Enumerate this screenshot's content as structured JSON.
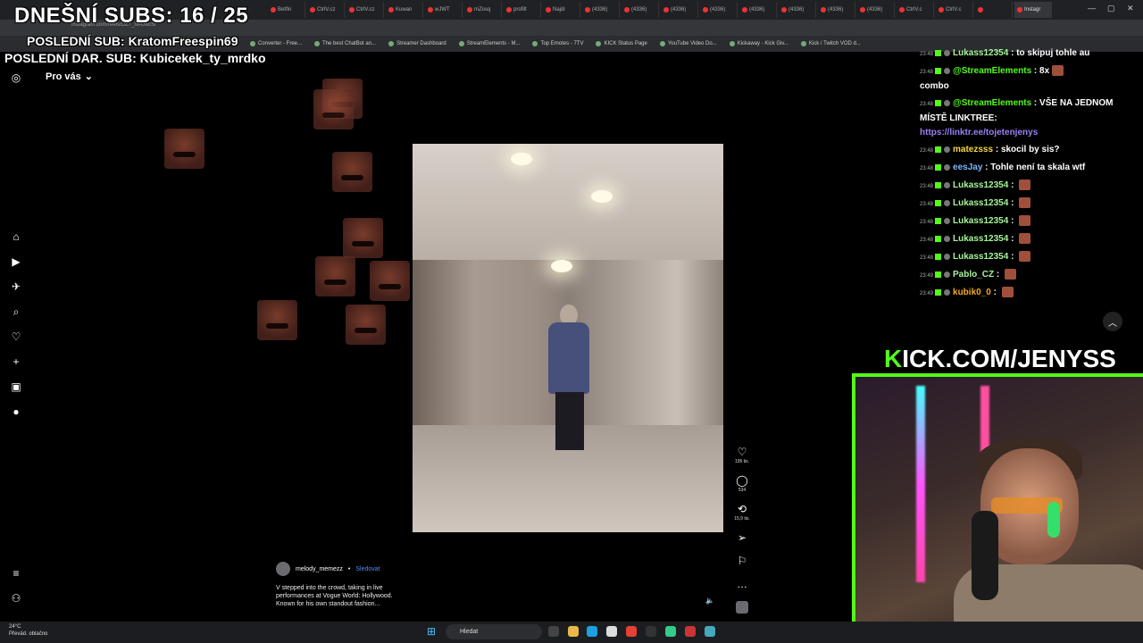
{
  "overlay": {
    "subs_goal": "DNEŠNÍ SUBS: 16 / 25",
    "last_sub": "POSLEDNÍ SUB: KratomFreespin69",
    "last_dar_sub": "POSLEDNÍ DAR. SUB: Kubicekek_ty_mrdko"
  },
  "browser": {
    "url": "instagram.com/reels/DZ7_t9AJwc5/",
    "tabs": [
      "Betfin",
      "CtrlV.cz",
      "CtrlV.cz",
      "Kuwan",
      "wJWT",
      "mZosq",
      "profilt",
      "Najdi",
      "(4336)",
      "(4336)",
      "(4336)",
      "(4336)",
      "(4336)",
      "(4336)",
      "(4336)",
      "(4336)",
      "CtrlV.c",
      "CtrlV.c",
      "",
      "Instagr"
    ],
    "bookmarks": [
      "Converter - Free...",
      "The best ChatBot an...",
      "Streamer Dashboard",
      "StreamElements - M...",
      "Top Emotes - 7TV",
      "KICK Status Page",
      "YouTube Video Do...",
      "Kickaway - Kick Giv...",
      "Kick / Twitch VOD d..."
    ]
  },
  "instagram": {
    "feed_label": "Pro vás",
    "actions": {
      "likes": "195 tis.",
      "comments": "534",
      "reposts": "15,9 tis."
    },
    "caption": {
      "username": "melody_memezz",
      "follow_label": "Sledovat",
      "text": "V stepped into the crowd, taking in live performances at Vogue World: Hollywood. Known for his own standout fashion..."
    }
  },
  "chat": {
    "messages": [
      {
        "time": "23:48",
        "user": "Lukass12354",
        "color": "#a6f59a",
        "text": "to skipuj tohle au"
      },
      {
        "time": "23:48",
        "user": "@StreamElements",
        "color": "#53fc18",
        "text": "8x",
        "suffix": "combo"
      },
      {
        "time": "23:48",
        "user": "@StreamElements",
        "color": "#53fc18",
        "text": "VŠE NA JEDNOM MÍSTĚ LINKTREE:",
        "link": "https://linktr.ee/tojetenjenys"
      },
      {
        "time": "23:48",
        "user": "matezsss",
        "color": "#f5d742",
        "text": "skocil by sis?"
      },
      {
        "time": "23:48",
        "user": "eesJay",
        "color": "#7ab7ff",
        "text": "Tohle není ta skala wtf"
      },
      {
        "time": "23:48",
        "user": "Lukass12354",
        "color": "#a6f59a",
        "text": ""
      },
      {
        "time": "23:48",
        "user": "Lukass12354",
        "color": "#a6f59a",
        "text": ""
      },
      {
        "time": "23:48",
        "user": "Lukass12354",
        "color": "#a6f59a",
        "text": ""
      },
      {
        "time": "23:48",
        "user": "Lukass12354",
        "color": "#a6f59a",
        "text": ""
      },
      {
        "time": "23:48",
        "user": "Lukass12354",
        "color": "#a6f59a",
        "text": ""
      },
      {
        "time": "23:49",
        "user": "Pablo_CZ",
        "color": "#a6f59a",
        "text": ""
      },
      {
        "time": "23:49",
        "user": "kubik0_0",
        "color": "#f5a623",
        "text": ""
      }
    ]
  },
  "kick_banner": {
    "k": "K",
    "rest": "ICK.COM/JENYSS"
  },
  "taskbar": {
    "weather_temp": "24°C",
    "weather_desc": "Převád. oblačno",
    "search_placeholder": "Hledat"
  },
  "colors": {
    "kick_green": "#53fc18",
    "link_purple": "#9b7ff5",
    "follow_blue": "#4a8ff5"
  }
}
